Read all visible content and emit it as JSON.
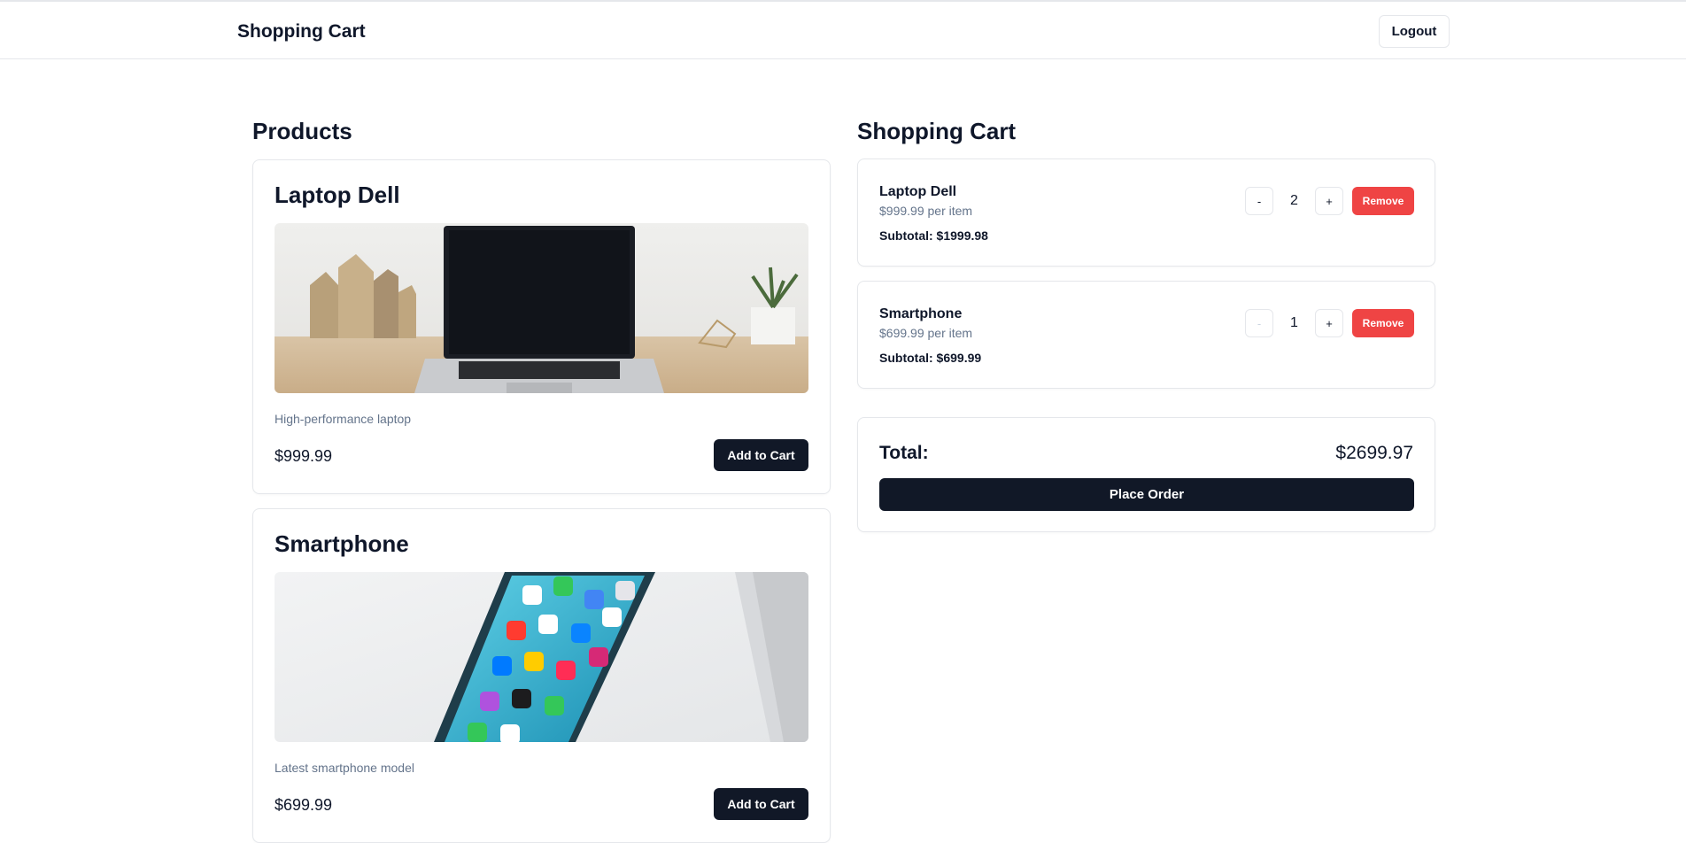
{
  "header": {
    "title": "Shopping Cart",
    "logout_label": "Logout"
  },
  "products": {
    "heading": "Products",
    "items": [
      {
        "name": "Laptop Dell",
        "description": "High-performance laptop",
        "price": "$999.99",
        "add_label": "Add to Cart",
        "image": "laptop-on-desk-photo"
      },
      {
        "name": "Smartphone",
        "description": "Latest smartphone model",
        "price": "$699.99",
        "add_label": "Add to Cart",
        "image": "smartphone-on-table-photo"
      }
    ]
  },
  "cart": {
    "heading": "Shopping Cart",
    "items": [
      {
        "name": "Laptop Dell",
        "unit_price": "$999.99 per item",
        "subtotal": "Subtotal: $1999.98",
        "quantity": "2",
        "minus_label": "-",
        "plus_label": "+",
        "remove_label": "Remove"
      },
      {
        "name": "Smartphone",
        "unit_price": "$699.99 per item",
        "subtotal": "Subtotal: $699.99",
        "quantity": "1",
        "minus_label": "-",
        "plus_label": "+",
        "remove_label": "Remove"
      }
    ],
    "total_label": "Total:",
    "total_value": "$2699.97",
    "place_order_label": "Place Order"
  },
  "colors": {
    "primary_button": "#111827",
    "danger_button": "#ef4444",
    "muted_text": "#64748b",
    "border": "#e5e7eb"
  }
}
